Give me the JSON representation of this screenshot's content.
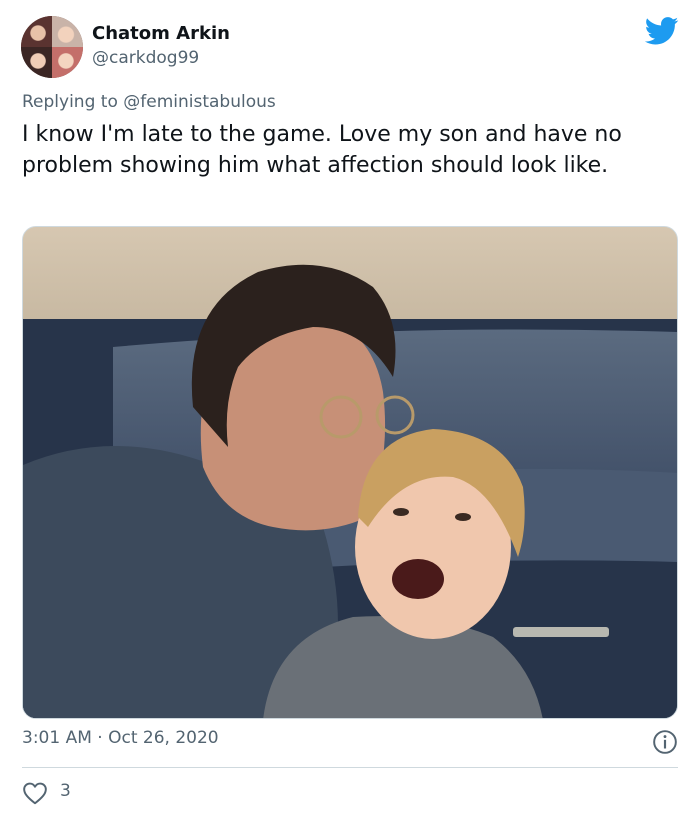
{
  "author": {
    "display_name": "Chatom Arkin",
    "handle": "@carkdog99",
    "avatar_icon": "family-photo-avatar"
  },
  "brand": {
    "icon": "twitter-bird-icon",
    "color": "#1d9bf0"
  },
  "reply": {
    "prefix": "Replying to",
    "mention": "@feministabulous"
  },
  "tweet": {
    "text": "I know I'm late to the game. Love my son and have no problem showing him what affection should look like."
  },
  "media": {
    "subject": "father-kissing-son-photo"
  },
  "meta": {
    "time": "3:01 AM",
    "separator": "·",
    "date": "Oct 26, 2020"
  },
  "actions": {
    "like_icon": "heart-icon",
    "like_count": "3",
    "info_icon": "info-icon"
  },
  "colors": {
    "text_primary": "#0f1419",
    "text_secondary": "#536471",
    "border": "#cfd9de"
  }
}
